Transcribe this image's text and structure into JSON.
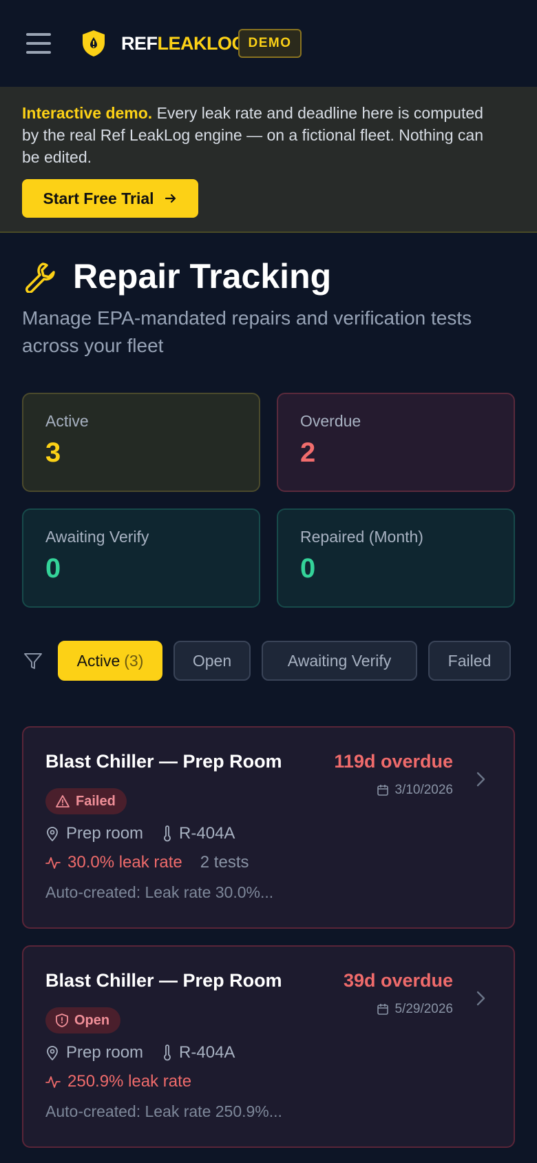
{
  "header": {
    "logo_ref": "REF",
    "logo_leak": "LEAKLOG",
    "demo_badge": "DEMO"
  },
  "banner": {
    "strong": "Interactive demo.",
    "text": " Every leak rate and deadline here is computed by the real Ref LeakLog engine — on a fictional fleet. Nothing can be edited.",
    "cta_label": "Start Free Trial"
  },
  "page": {
    "title": "Repair Tracking",
    "subtitle": "Manage EPA-mandated repairs and verification tests across your fleet"
  },
  "stats": [
    {
      "label": "Active",
      "value": "3",
      "color": "#fcd116"
    },
    {
      "label": "Overdue",
      "value": "2",
      "color": "#f26d6d"
    },
    {
      "label": "Awaiting Verify",
      "value": "0",
      "color": "#34d399"
    },
    {
      "label": "Repaired (Month)",
      "value": "0",
      "color": "#34d399"
    }
  ],
  "filters": [
    {
      "label": "Active",
      "count": "(3)",
      "selected": true
    },
    {
      "label": "Open"
    },
    {
      "label": "Awaiting Verify"
    },
    {
      "label": "Failed"
    }
  ],
  "repairs": [
    {
      "title": "Blast Chiller — Prep Room",
      "overdue": "119d overdue",
      "date": "3/10/2026",
      "status": "Failed",
      "location": "Prep room",
      "refrigerant": "R-404A",
      "leak_rate": "30.0% leak rate",
      "tests": "2 tests",
      "note": "Auto-created: Leak rate 30.0%..."
    },
    {
      "title": "Blast Chiller — Prep Room",
      "overdue": "39d overdue",
      "date": "5/29/2026",
      "status": "Open",
      "location": "Prep room",
      "refrigerant": "R-404A",
      "leak_rate": "250.9% leak rate",
      "note": "Auto-created: Leak rate 250.9%..."
    }
  ]
}
